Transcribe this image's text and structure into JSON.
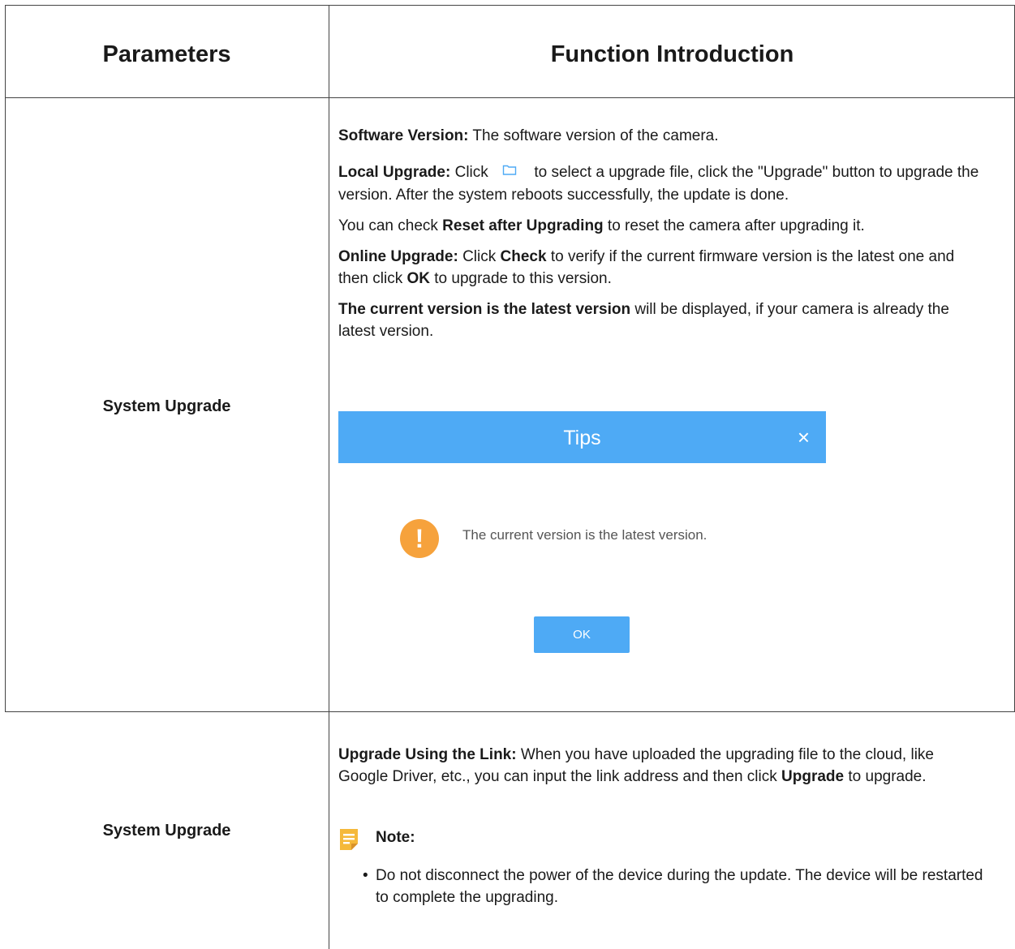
{
  "header": {
    "col_parameters": "Parameters",
    "col_function": "Function Introduction"
  },
  "row1": {
    "label": "System Upgrade",
    "software_version_term": "Software Version:",
    "software_version_text": " The software version of the camera.",
    "local_upgrade_term": "Local Upgrade:",
    "local_upgrade_click": " Click ",
    "local_upgrade_text": " to select a upgrade file, click the \"Upgrade\" button to upgrade the version. After the system reboots successfully, the update is done.",
    "reset_pre": "You can check ",
    "reset_term": "Reset after Upgrading",
    "reset_post": " to reset the camera after upgrading it.",
    "online_term": "Online Upgrade:",
    "online_click": " Click ",
    "online_check": "Check",
    "online_mid": " to verify if the current firmware version is the latest one and then click ",
    "online_ok": "OK",
    "online_post": " to upgrade to this version.",
    "latest_term": "The current version is the latest version",
    "latest_post": " will be displayed, if your camera is already the latest version."
  },
  "dialog": {
    "title": "Tips",
    "close": "×",
    "warn": "!",
    "message": "The current version is the latest version.",
    "ok": "OK"
  },
  "row2": {
    "label": "System Upgrade",
    "link_term": "Upgrade Using the Link:",
    "link_text": " When you have uploaded the upgrading file to the cloud, like Google Driver, etc., you can input the link address and then click ",
    "link_upgrade": "Upgrade",
    "link_post": " to upgrade.",
    "note_label": "Note:",
    "bullet_dot": "•",
    "bullet_text": "Do not disconnect the power of the device during the update. The device will be restarted to complete the upgrading."
  },
  "colors": {
    "dialog_blue": "#4eaaf5",
    "warning_orange": "#f6a23c",
    "note_yellow": "#f5b93a"
  }
}
